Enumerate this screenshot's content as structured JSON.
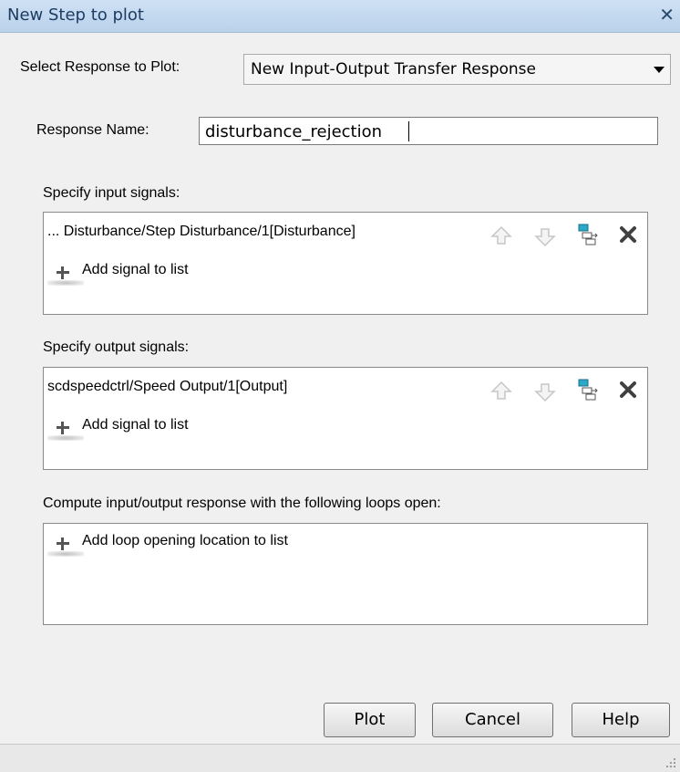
{
  "window": {
    "title": "New Step to plot",
    "close_glyph": "✕"
  },
  "response_select": {
    "label": "Select Response to Plot:",
    "value": "New Input-Output Transfer Response"
  },
  "response_name": {
    "label": "Response Name:",
    "value": "disturbance_rejection"
  },
  "input_signals": {
    "label": "Specify input signals:",
    "items": [
      "... Disturbance/Step Disturbance/1[Disturbance]"
    ],
    "add_label": "Add signal to list"
  },
  "output_signals": {
    "label": "Specify output signals:",
    "items": [
      "scdspeedctrl/Speed Output/1[Output]"
    ],
    "add_label": "Add signal to list"
  },
  "loops": {
    "label": "Compute input/output response with the following loops open:",
    "add_label": "Add loop opening location to list"
  },
  "buttons": {
    "plot": "Plot",
    "cancel": "Cancel",
    "help": "Help"
  },
  "icons": [
    "move-up-icon",
    "move-down-icon",
    "highlight-in-model-icon",
    "delete-icon",
    "add-icon",
    "dropdown-arrow-icon",
    "resize-grip-icon"
  ],
  "colors": {
    "titlebar": "#c4d8ee",
    "window_bg": "#f0f0f0",
    "icon_highlight": "#2aa9c9",
    "delete_icon": "#404040"
  }
}
